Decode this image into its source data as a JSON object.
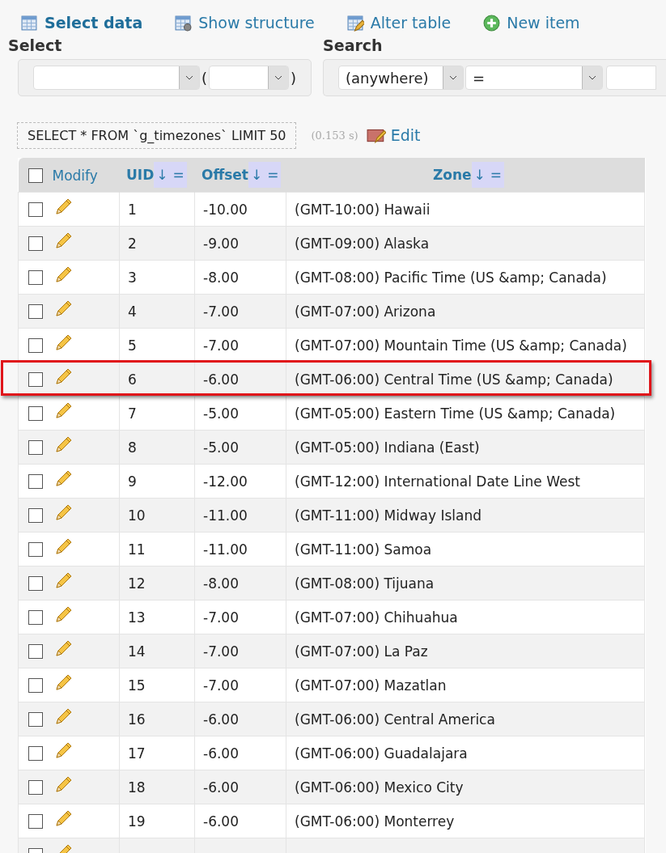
{
  "menu": [
    {
      "kind": "table",
      "label": "Select data",
      "selected": true
    },
    {
      "kind": "structure",
      "label": "Show structure",
      "selected": false
    },
    {
      "kind": "alter",
      "label": "Alter table",
      "selected": false
    },
    {
      "kind": "new",
      "label": "New item",
      "selected": false
    }
  ],
  "select": {
    "title": "Select",
    "open_paren": "(",
    "close_paren": ")"
  },
  "search": {
    "title": "Search",
    "column": "(anywhere)",
    "operator": "="
  },
  "query": {
    "sql": "SELECT * FROM `g_timezones` LIMIT 50",
    "time": "(0.153 s)",
    "edit": "Edit"
  },
  "table": {
    "modify": "Modify",
    "all_checked": false,
    "columns": [
      {
        "label": "UID",
        "sort": "↓",
        "filter": "="
      },
      {
        "label": "Offset",
        "sort": "↓",
        "filter": "="
      },
      {
        "label": "Zone",
        "sort": "↓",
        "filter": "="
      }
    ],
    "rows": [
      {
        "checked": false,
        "highlighted": false,
        "cells": [
          "1",
          "-10.00",
          "(GMT-10:00) Hawaii"
        ]
      },
      {
        "checked": false,
        "highlighted": false,
        "cells": [
          "2",
          "-9.00",
          "(GMT-09:00) Alaska"
        ]
      },
      {
        "checked": false,
        "highlighted": false,
        "cells": [
          "3",
          "-8.00",
          "(GMT-08:00) Pacific Time (US &amp; Canada)"
        ]
      },
      {
        "checked": false,
        "highlighted": false,
        "cells": [
          "4",
          "-7.00",
          "(GMT-07:00) Arizona"
        ]
      },
      {
        "checked": false,
        "highlighted": false,
        "cells": [
          "5",
          "-7.00",
          "(GMT-07:00) Mountain Time (US &amp; Canada)"
        ]
      },
      {
        "checked": false,
        "highlighted": true,
        "cells": [
          "6",
          "-6.00",
          "(GMT-06:00) Central Time (US &amp; Canada)"
        ]
      },
      {
        "checked": false,
        "highlighted": false,
        "cells": [
          "7",
          "-5.00",
          "(GMT-05:00) Eastern Time (US &amp; Canada)"
        ]
      },
      {
        "checked": false,
        "highlighted": false,
        "cells": [
          "8",
          "-5.00",
          "(GMT-05:00) Indiana (East)"
        ]
      },
      {
        "checked": false,
        "highlighted": false,
        "cells": [
          "9",
          "-12.00",
          "(GMT-12:00) International Date Line West"
        ]
      },
      {
        "checked": false,
        "highlighted": false,
        "cells": [
          "10",
          "-11.00",
          "(GMT-11:00) Midway Island"
        ]
      },
      {
        "checked": false,
        "highlighted": false,
        "cells": [
          "11",
          "-11.00",
          "(GMT-11:00) Samoa"
        ]
      },
      {
        "checked": false,
        "highlighted": false,
        "cells": [
          "12",
          "-8.00",
          "(GMT-08:00) Tijuana"
        ]
      },
      {
        "checked": false,
        "highlighted": false,
        "cells": [
          "13",
          "-7.00",
          "(GMT-07:00) Chihuahua"
        ]
      },
      {
        "checked": false,
        "highlighted": false,
        "cells": [
          "14",
          "-7.00",
          "(GMT-07:00) La Paz"
        ]
      },
      {
        "checked": false,
        "highlighted": false,
        "cells": [
          "15",
          "-7.00",
          "(GMT-07:00) Mazatlan"
        ]
      },
      {
        "checked": false,
        "highlighted": false,
        "cells": [
          "16",
          "-6.00",
          "(GMT-06:00) Central America"
        ]
      },
      {
        "checked": false,
        "highlighted": false,
        "cells": [
          "17",
          "-6.00",
          "(GMT-06:00) Guadalajara"
        ]
      },
      {
        "checked": false,
        "highlighted": false,
        "cells": [
          "18",
          "-6.00",
          "(GMT-06:00) Mexico City"
        ]
      },
      {
        "checked": false,
        "highlighted": false,
        "cells": [
          "19",
          "-6.00",
          "(GMT-06:00) Monterrey"
        ]
      },
      {
        "checked": false,
        "highlighted": false,
        "cells": [
          "",
          "",
          ""
        ]
      }
    ]
  }
}
